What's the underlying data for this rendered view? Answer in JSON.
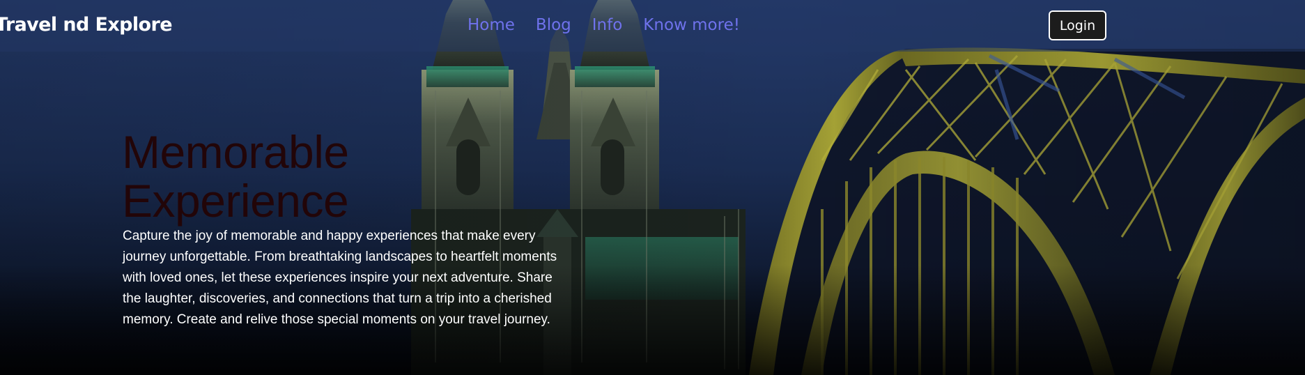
{
  "navbar": {
    "brand": "Travel nd Explore",
    "links": [
      {
        "label": "Home"
      },
      {
        "label": "Blog"
      },
      {
        "label": "Info"
      },
      {
        "label": "Know more!"
      }
    ],
    "login_label": "Login",
    "link_color": "#6f72ec"
  },
  "hero": {
    "title_line1": "Memorable",
    "title_line2": "Experience",
    "title_color": "#220508",
    "description": "Capture the joy of memorable and happy experiences that make every journey unforgettable. From breathtaking landscapes to heartfelt moments with loved ones, let these experiences inspire your next adventure. Share the laughter, discoveries, and connections that turn a trip into a cherished memory. Create and relive those special moments on your travel journey."
  },
  "background": {
    "depicts": [
      "cathedral",
      "arched-steel-bridge",
      "night-sky"
    ]
  }
}
